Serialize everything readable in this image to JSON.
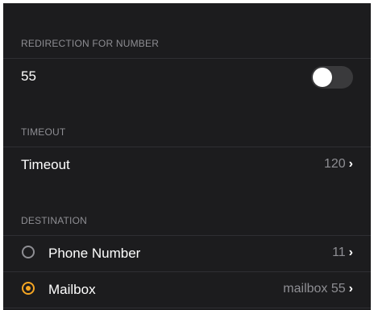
{
  "sections": {
    "redirection": {
      "header": "REDIRECTION FOR NUMBER",
      "row_label": "55",
      "toggle_on": false
    },
    "timeout": {
      "header": "TIMEOUT",
      "row_label": "Timeout",
      "row_value": "120"
    },
    "destination": {
      "header": "DESTINATION",
      "options": [
        {
          "label": "Phone Number",
          "value": "11",
          "selected": false
        },
        {
          "label": "Mailbox",
          "value": "mailbox 55",
          "selected": true
        }
      ]
    }
  },
  "icons": {
    "chevron": "chevron-right-icon",
    "radio_off": "radio-unselected-icon",
    "radio_on": "radio-selected-icon"
  },
  "colors": {
    "background": "#1c1c1e",
    "accent": "#f5a623",
    "secondary_text": "#8e8e93"
  }
}
